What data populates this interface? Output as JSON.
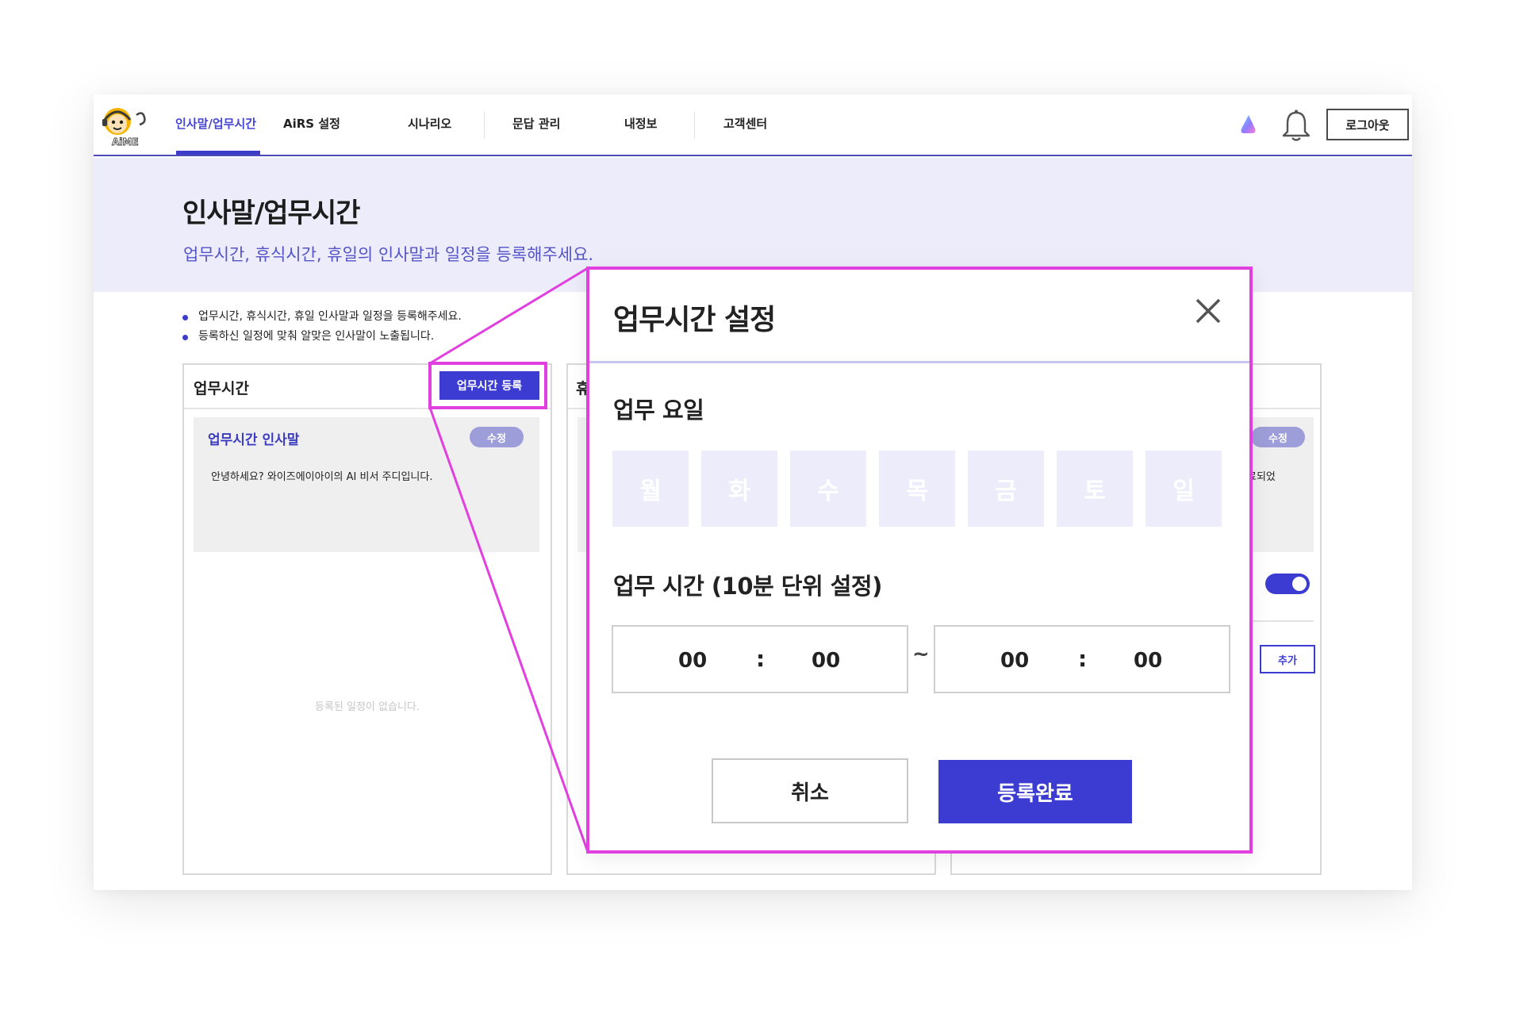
{
  "nav": {
    "tabs": [
      {
        "label": "인사말/업무시간",
        "active": true
      },
      {
        "label": "AiRS 설정"
      },
      {
        "label": "시나리오"
      },
      {
        "label": "문답 관리"
      },
      {
        "label": "내정보"
      },
      {
        "label": "고객센터"
      }
    ],
    "logout_label": "로그아웃",
    "logo_text": "AiME",
    "icons": [
      "cloud-icon",
      "bell-icon"
    ]
  },
  "hero": {
    "title": "인사말/업무시간",
    "subtitle": "업무시간, 휴식시간, 휴일의 인사말과 일정을 등록해주세요."
  },
  "notes": [
    "업무시간, 휴식시간, 휴일 인사말과 일정을 등록해주세요.",
    "등록하신 일정에 맞춰 알맞은 인사말이 노출됩니다."
  ],
  "panel_work": {
    "title": "업무시간",
    "register_label": "업무시간 등록",
    "greeting_title": "업무시간 인사말",
    "edit_label": "수정",
    "greeting_text": "안녕하세요? 와이즈에이아이의 AI 비서  주디입니다.",
    "empty_text": "등록된 일정이 없습니다."
  },
  "panel_middle": {
    "title_fragment": "휴"
  },
  "panel_right": {
    "edit_label": "수정",
    "text_fragment": "료되었",
    "add_label": "추가",
    "toggle_on": true
  },
  "modal": {
    "title": "업무시간 설정",
    "days_label": "업무 요일",
    "days": [
      "월",
      "화",
      "수",
      "목",
      "금",
      "토",
      "일"
    ],
    "time_label": "업무 시간 (10분 단위 설정)",
    "start": {
      "hour": "00",
      "minute": "00"
    },
    "end": {
      "hour": "00",
      "minute": "00"
    },
    "separator": ":",
    "range_separator": "~",
    "cancel_label": "취소",
    "complete_label": "등록완료"
  },
  "colors": {
    "accent": "#3c3cd2",
    "highlight": "#e13fe0",
    "hero_bg": "#ececfa"
  }
}
